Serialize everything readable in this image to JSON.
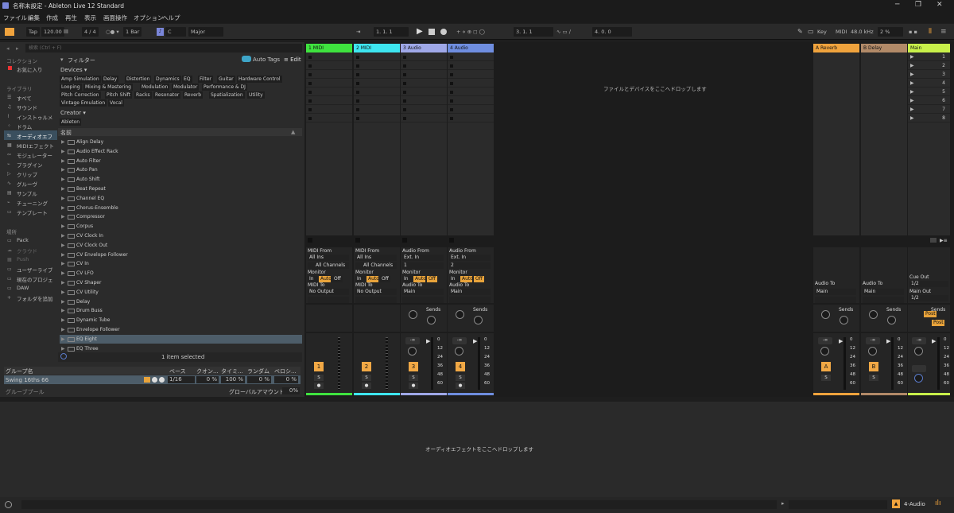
{
  "window": {
    "title": "名称未設定 - Ableton Live 12 Standard"
  },
  "menu": [
    "ファイル",
    "編集",
    "作成",
    "再生",
    "表示",
    "画面操作",
    "オプション",
    "ヘルプ"
  ],
  "transport": {
    "tap": "Tap",
    "tempo": "120.00",
    "signature": "4 / 4",
    "bar": "1 Bar",
    "key_root": "C",
    "scale": "Major",
    "position": "1.   1.   1",
    "loop_start": "3.   1.   1",
    "loop_length": "4.   0.   0",
    "key_label": "Key",
    "midi_label": "MIDI",
    "sample_rate": "48.0 kHz",
    "cpu": "2 %"
  },
  "browser": {
    "search_placeholder": "検索 (Ctrl + F)",
    "collections_head": "コレクション",
    "favorites": "お気に入り",
    "library_head": "ライブラリ",
    "library_items": [
      "すべて",
      "サウンド",
      "インストゥルメ",
      "ドラム",
      "オーディオエフ",
      "MIDIエフェクト",
      "モジュレーター",
      "プラグイン",
      "クリップ",
      "グルーヴ",
      "サンプル",
      "チューニング",
      "テンプレート"
    ],
    "places_head": "場所",
    "places_items": [
      "Pack",
      "クラウド",
      "Push",
      "ユーザーライブ",
      "現在のプロジェ",
      "DAW",
      "フォルダを追加"
    ],
    "filter_label": "フィルター",
    "auto_tags": "Auto Tags",
    "edit": "Edit",
    "devices_label": "Devices",
    "device_tags": [
      "Amp Simulation",
      "Delay",
      "Distortion",
      "Dynamics",
      "EQ",
      "Filter",
      "Guitar",
      "Hardware Control",
      "Looping",
      "Mixing & Mastering",
      "Modulation",
      "Modulator",
      "Performance & DJ",
      "Pitch Correction",
      "Pitch Shift",
      "Racks",
      "Resonator",
      "Reverb",
      "Spatialization",
      "Utility",
      "Vintage Emulation",
      "Vocal"
    ],
    "creator_label": "Creator",
    "creator_tag": "Ableton",
    "name_header": "名前",
    "items": [
      "Align Delay",
      "Audio Effect Rack",
      "Auto Filter",
      "Auto Pan",
      "Auto Shift",
      "Beat Repeat",
      "Channel EQ",
      "Chorus-Ensemble",
      "Compressor",
      "Corpus",
      "CV Clock In",
      "CV Clock Out",
      "CV Envelope Follower",
      "CV In",
      "CV LFO",
      "CV Shaper",
      "CV Utility",
      "Delay",
      "Drum Buss",
      "Dynamic Tube",
      "Envelope Follower",
      "EQ Eight",
      "EQ Three"
    ],
    "selected_status": "1 item selected"
  },
  "groove": {
    "headers": [
      "グループ名",
      "ベース",
      "クオン...",
      "タイミ...",
      "ランダム",
      "ベロシ..."
    ],
    "row": {
      "name": "Swing 16ths 66",
      "base": "1/16",
      "quant": "0 %",
      "timing": "100 %",
      "random": "0 %",
      "velocity": "0 %"
    },
    "pool_label": "グルーブプール",
    "global_label": "グローバルアマウント",
    "global_value": "0%"
  },
  "tracks": [
    {
      "name": "1 MIDI",
      "color": "#3fe33f",
      "num": "1",
      "type": "midi",
      "from_label": "MIDI From",
      "from": "All Ins",
      "sub": "All Channels",
      "to_label": "MIDI To",
      "to": "No Output"
    },
    {
      "name": "2 MIDI",
      "color": "#3ee6f0",
      "num": "2",
      "type": "midi",
      "from_label": "MIDI From",
      "from": "All Ins",
      "sub": "All Channels",
      "to_label": "MIDI To",
      "to": "No Output"
    },
    {
      "name": "3 Audio",
      "color": "#9fa8e8",
      "num": "3",
      "type": "audio",
      "from_label": "Audio From",
      "from": "Ext. In",
      "sub": "1",
      "to_label": "Audio To",
      "to": "Main"
    },
    {
      "name": "4 Audio",
      "color": "#6f8ee0",
      "num": "4",
      "type": "audio",
      "from_label": "Audio From",
      "from": "Ext. In",
      "sub": "2",
      "to_label": "Audio To",
      "to": "Main"
    }
  ],
  "returns": [
    {
      "name": "A Reverb",
      "color": "#f0a33d",
      "letter": "A",
      "to": "Main"
    },
    {
      "name": "B Delay",
      "color": "#b28a68",
      "letter": "B",
      "to": "Main"
    }
  ],
  "main": {
    "name": "Main",
    "color": "#c8f04a",
    "scenes": [
      "1",
      "2",
      "3",
      "4",
      "5",
      "6",
      "7",
      "8"
    ],
    "cue_label": "Cue Out",
    "cue": "1/2",
    "out_label": "Main Out",
    "out": "1/2",
    "post": "Post"
  },
  "mixer": {
    "monitor": "Monitor",
    "in": "In",
    "auto": "Auto",
    "off": "Off",
    "sends": "Sends",
    "solo": "S",
    "vol": "-∞",
    "db_marks": [
      "0",
      "12",
      "24",
      "36",
      "48",
      "60"
    ],
    "audio_to": "Audio To"
  },
  "drop_hint": "ファイルとデバイスをここへドロップします",
  "device_drop_hint": "オーディオエフェクトをここへドロップします",
  "status": {
    "track": "4-Audio"
  }
}
